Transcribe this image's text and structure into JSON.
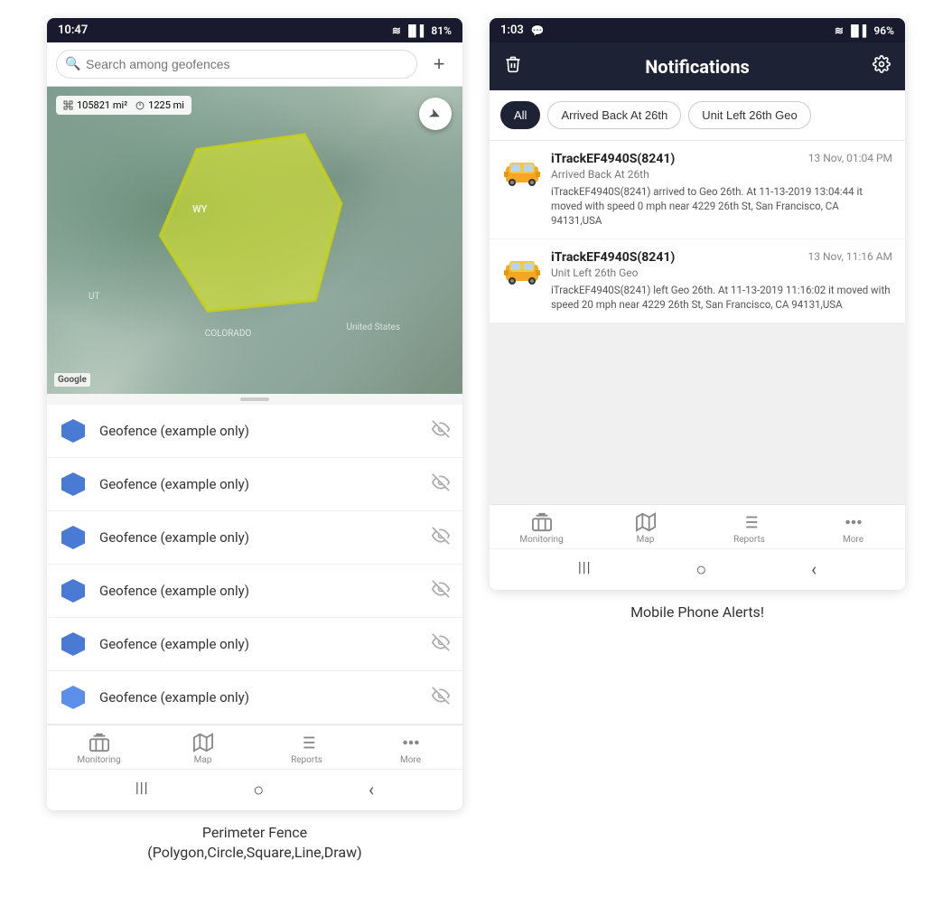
{
  "left_phone": {
    "status_bar": {
      "time": "10:47",
      "battery": "81%",
      "signal": "WiFi"
    },
    "search": {
      "placeholder": "Search among geofences"
    },
    "map_stats": {
      "area": "105821 mi²",
      "distance": "1225 mi"
    },
    "map_labels": {
      "wy": "WY",
      "us": "United States",
      "colorado": "COLORADO",
      "ut": "UT"
    },
    "geofences": [
      {
        "label": "Geofence (example only)"
      },
      {
        "label": "Geofence (example only)"
      },
      {
        "label": "Geofence (example only)"
      },
      {
        "label": "Geofence (example only)"
      },
      {
        "label": "Geofence (example only)"
      },
      {
        "label": "Geofence (example only)"
      }
    ],
    "nav": {
      "items": [
        {
          "label": "Monitoring",
          "icon": "🚌"
        },
        {
          "label": "Map",
          "icon": "🗺"
        },
        {
          "label": "Reports",
          "icon": "📊"
        },
        {
          "label": "More",
          "icon": "···"
        }
      ]
    },
    "caption": "Perimeter Fence\n(Polygon,Circle,Square,Line,Draw)"
  },
  "right_phone": {
    "status_bar": {
      "time": "1:03",
      "battery": "96%"
    },
    "header": {
      "title": "Notifications",
      "delete_icon": "🗑",
      "settings_icon": "⚙"
    },
    "filters": {
      "all": "All",
      "filter1": "Arrived Back At 26th",
      "filter2": "Unit Left 26th Geo",
      "active": "All"
    },
    "notifications": [
      {
        "device": "iTrackEF4940S(8241)",
        "time": "13 Nov, 01:04 PM",
        "event": "Arrived Back At 26th",
        "body": "iTrackEF4940S(8241) arrived to Geo 26th.   At 11-13-2019 13:04:44 it moved with speed 0 mph near 4229 26th St, San Francisco, CA 94131,USA"
      },
      {
        "device": "iTrackEF4940S(8241)",
        "time": "13 Nov, 11:16 AM",
        "event": "Unit Left 26th Geo",
        "body": "iTrackEF4940S(8241) left Geo 26th.   At 11-13-2019 11:16:02 it moved with speed 20 mph near 4229 26th St, San Francisco, CA 94131,USA"
      }
    ],
    "nav": {
      "items": [
        {
          "label": "Monitoring",
          "icon": "🚌"
        },
        {
          "label": "Map",
          "icon": "🗺"
        },
        {
          "label": "Reports",
          "icon": "📊"
        },
        {
          "label": "More",
          "icon": "···"
        }
      ]
    },
    "caption": "Mobile Phone Alerts!"
  },
  "icons": {
    "search": "🔍",
    "add": "+",
    "compass": "➤",
    "eye_off": "👁",
    "trash": "🗑",
    "settings": "⚙",
    "hexagon_blue": "⬡",
    "car_yellow": "🚕",
    "android_recent": "|||",
    "android_home": "○",
    "android_back": "‹"
  }
}
